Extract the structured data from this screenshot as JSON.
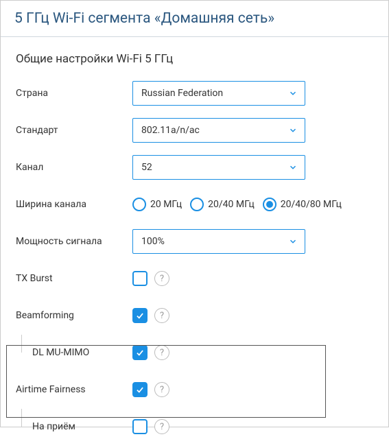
{
  "header": {
    "title": "5 ГГц Wi-Fi сегмента «Домашняя сеть»"
  },
  "section": {
    "title": "Общие настройки Wi-Fi 5 ГГц"
  },
  "fields": {
    "country": {
      "label": "Страна",
      "value": "Russian Federation"
    },
    "standard": {
      "label": "Стандарт",
      "value": "802.11a/n/ac"
    },
    "channel": {
      "label": "Канал",
      "value": "52"
    },
    "width": {
      "label": "Ширина канала",
      "options": [
        "20 МГц",
        "20/40 МГц",
        "20/40/80 МГц"
      ],
      "selected": 2
    },
    "power": {
      "label": "Мощность сигнала",
      "value": "100%"
    },
    "txburst": {
      "label": "TX Burst",
      "checked": false
    },
    "beamform": {
      "label": "Beamforming",
      "checked": true
    },
    "mumimo": {
      "label": "DL MU-MIMO",
      "checked": true
    },
    "airtime": {
      "label": "Airtime Fairness",
      "checked": true
    },
    "rx": {
      "label": "На приём",
      "checked": false
    }
  },
  "icons": {
    "help_glyph": "?"
  }
}
